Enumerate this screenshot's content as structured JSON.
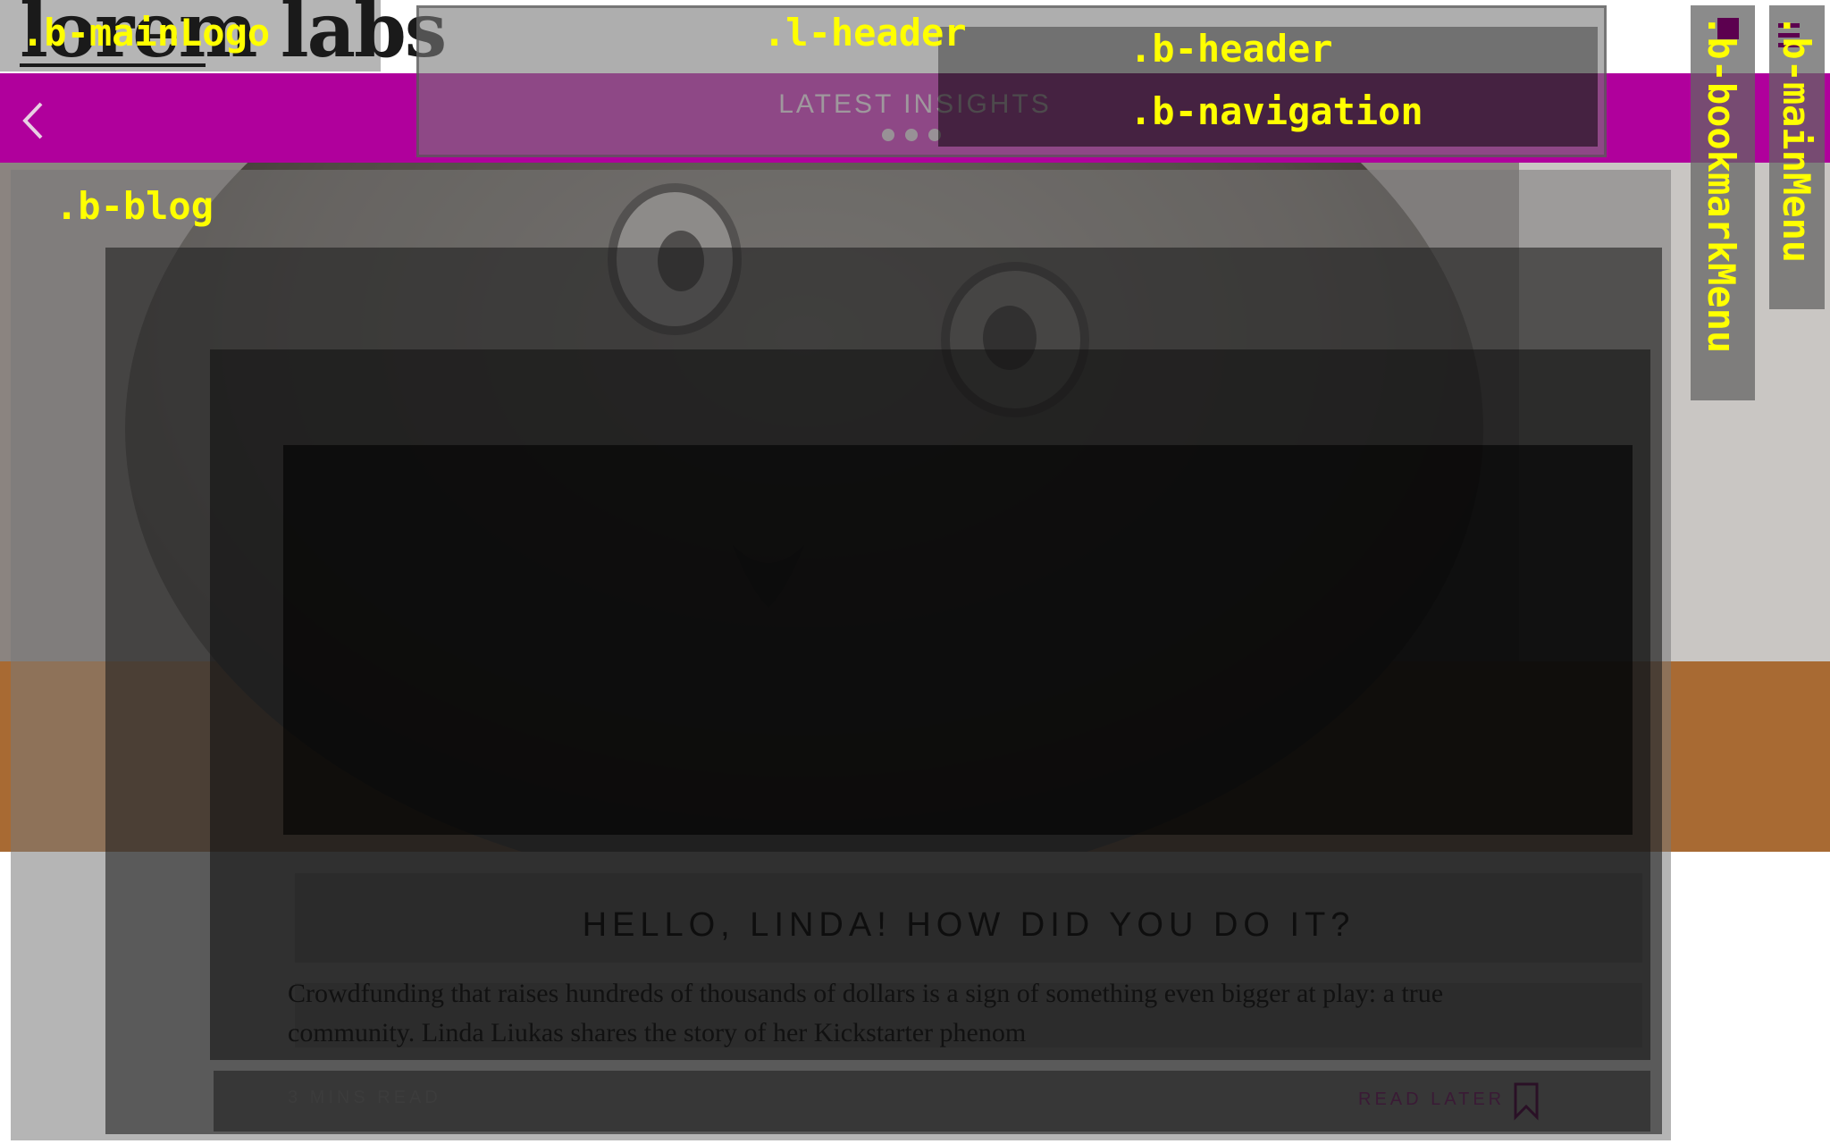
{
  "logo": {
    "text": "lorem labs"
  },
  "nav": {
    "title": "LATEST INSIGHTS",
    "slides": 3,
    "active_slide": 1
  },
  "post": {
    "title": "HELLO, LINDA! HOW DID YOU DO IT?",
    "excerpt_line1": "Crowdfunding that raises hundreds of thousands of dollars is a sign of something even bigger at play: a true",
    "excerpt_line2": "community. Linda Liukas shares the story of her Kickstarter phenom",
    "read_time": "3 MINS READ",
    "read_later": "READ LATER"
  },
  "overlay_labels": {
    "main_logo": ".b-mainLogo",
    "l_header": ".l-header",
    "b_header": ".b-header",
    "b_navigation": ".b-navigation",
    "b_blog": ".b-blog",
    "b_bookmark_menu": ".b-bookmarkMenu",
    "b_main_menu": ".b-mainMenu"
  },
  "colors": {
    "nav_bar": "#b0009c",
    "overlay_label": "#ffff00"
  }
}
